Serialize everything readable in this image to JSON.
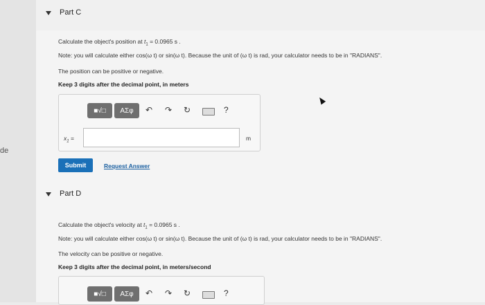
{
  "sidebar": {
    "fragment_text": "de"
  },
  "partC": {
    "title": "Part C",
    "calc_prefix": "Calculate the object's position at ",
    "calc_time": "t",
    "calc_time_sub": "1",
    "calc_value": " = 0.0965 s .",
    "note": "Note: you will calculate either cos(ω t) or sin(ω t). Because the unit of (ω t) is rad, your calculator needs to be in \"RADIANS\".",
    "sign_note": "The position can be positive or negative.",
    "instruction": "Keep 3 digits after the decimal point, in meters",
    "toolbar": {
      "templates_label": "■√□",
      "greek_label": "ΑΣφ",
      "undo": "↶",
      "redo": "↷",
      "reset": "↻",
      "help": "?"
    },
    "input_label": "x",
    "input_label_sub": "1",
    "input_label_eq": " =",
    "input_value": "",
    "unit": "m",
    "submit_label": "Submit",
    "request_label": "Request Answer"
  },
  "partD": {
    "title": "Part D",
    "calc_prefix": "Calculate the object's velocity at ",
    "calc_time": "t",
    "calc_time_sub": "1",
    "calc_value": " = 0.0965 s .",
    "note": "Note: you will calculate either cos(ω t) or sin(ω t). Because the unit of (ω t) is rad, your calculator needs to be in \"RADIANS\".",
    "sign_note": "The velocity can be positive or negative.",
    "instruction": "Keep 3 digits after the decimal point, in meters/second",
    "toolbar": {
      "templates_label": "■√□",
      "greek_label": "ΑΣφ",
      "undo": "↶",
      "redo": "↷",
      "reset": "↻",
      "help": "?"
    }
  }
}
